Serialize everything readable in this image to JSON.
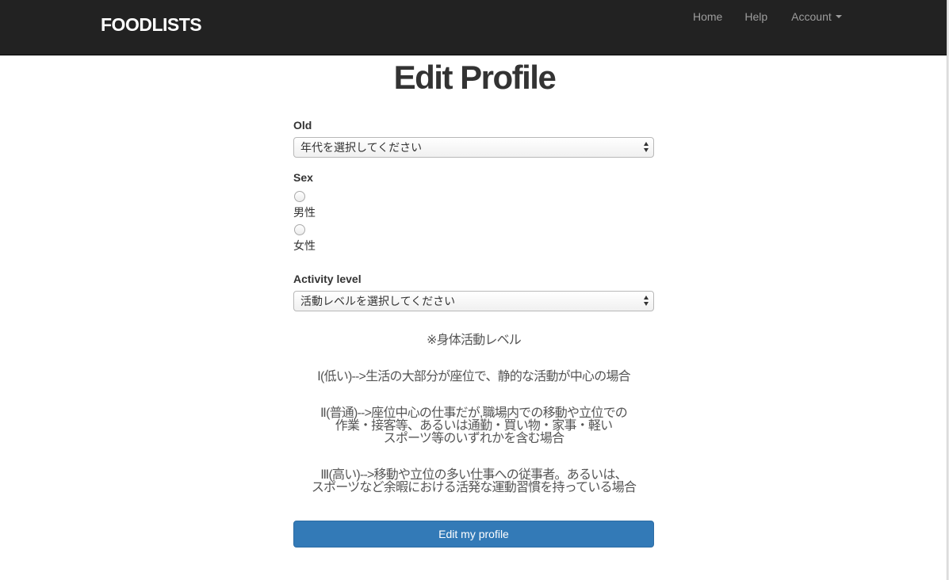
{
  "navbar": {
    "brand": "FOODLISTS",
    "home": "Home",
    "help": "Help",
    "account": "Account"
  },
  "page_title": "Edit Profile",
  "form": {
    "old_label": "Old",
    "old_selected": "年代を選択してください",
    "sex_label": "Sex",
    "sex_options": [
      "男性",
      "女性"
    ],
    "activity_label": "Activity level",
    "activity_selected": "活動レベルを選択してください"
  },
  "notes": {
    "heading": "※身体活動レベル",
    "level1": "Ⅰ(低い)-->生活の大部分が座位で、静的な活動が中心の場合",
    "level2_line1": "Ⅱ(普通)-->座位中心の仕事だが,職場内での移動や立位での",
    "level2_line2": "作業・接客等、あるいは通勤・買い物・家事・軽い",
    "level2_line3": "スポーツ等のいずれかを含む場合",
    "level3_line1": "Ⅲ(高い)-->移動や立位の多い仕事への従事者。あるいは、",
    "level3_line2": "スポーツなど余暇における活発な運動習慣を持っている場合"
  },
  "submit_label": "Edit my profile"
}
